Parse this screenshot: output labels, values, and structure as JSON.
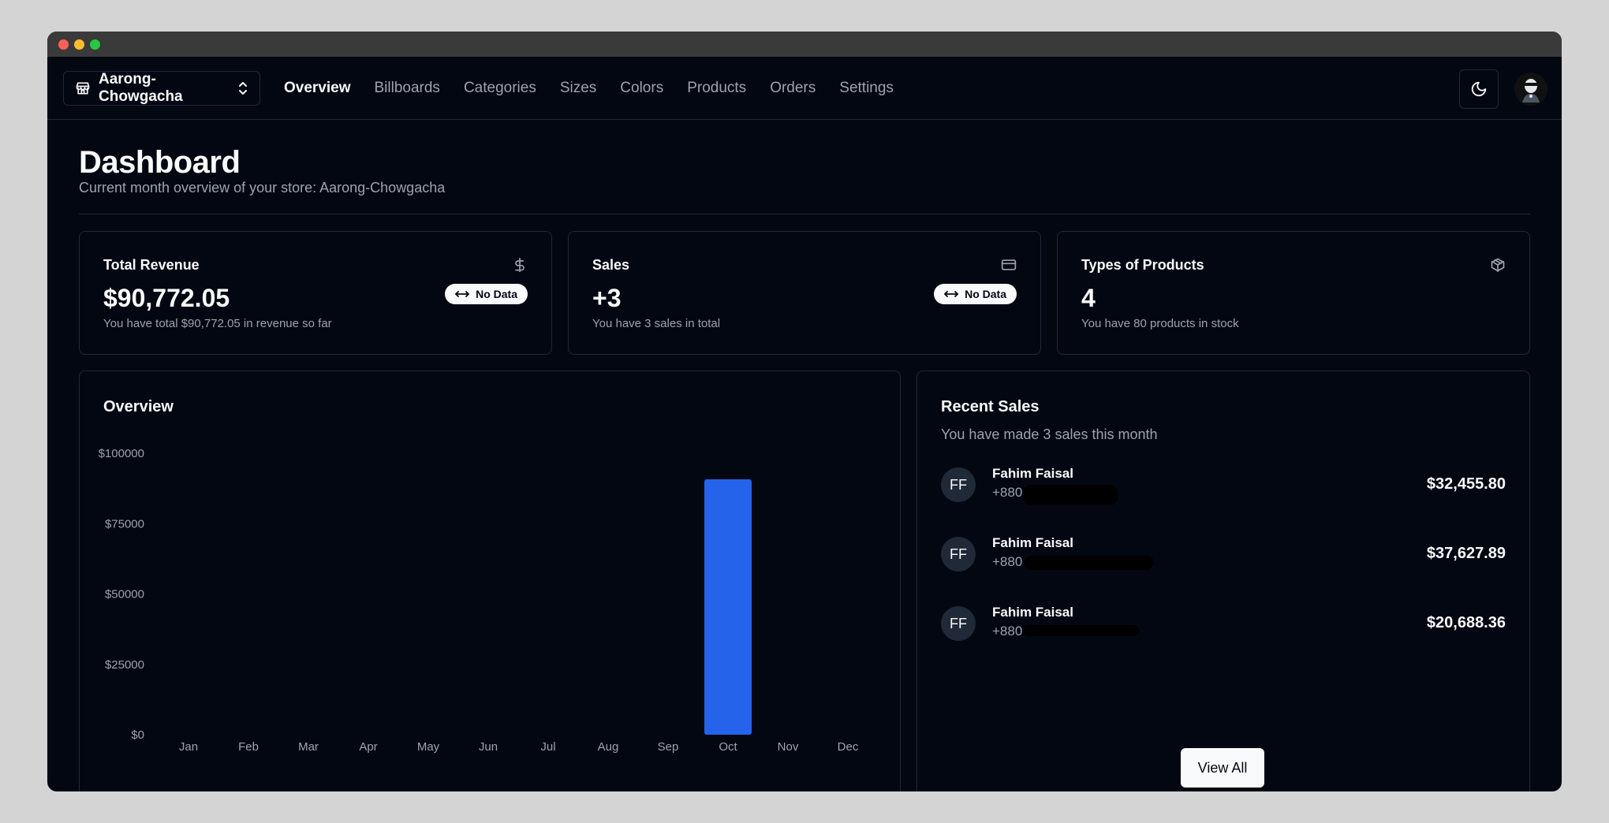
{
  "store": {
    "name": "Aarong-Chowgacha"
  },
  "nav": {
    "items": [
      {
        "label": "Overview",
        "active": true
      },
      {
        "label": "Billboards",
        "active": false
      },
      {
        "label": "Categories",
        "active": false
      },
      {
        "label": "Sizes",
        "active": false
      },
      {
        "label": "Colors",
        "active": false
      },
      {
        "label": "Products",
        "active": false
      },
      {
        "label": "Orders",
        "active": false
      },
      {
        "label": "Settings",
        "active": false
      }
    ]
  },
  "header": {
    "title": "Dashboard",
    "subtitle": "Current month overview of your store: Aarong-Chowgacha"
  },
  "stats": [
    {
      "title": "Total Revenue",
      "value": "$90,772.05",
      "desc": "You have total $90,772.05 in revenue so far",
      "icon": "dollar-icon",
      "badge": "No Data"
    },
    {
      "title": "Sales",
      "value": "+3",
      "desc": "You have 3 sales in total",
      "icon": "credit-card-icon",
      "badge": "No Data"
    },
    {
      "title": "Types of Products",
      "value": "4",
      "desc": "You have 80 products in stock",
      "icon": "package-icon"
    }
  ],
  "overview": {
    "title": "Overview"
  },
  "chart_data": {
    "type": "bar",
    "title": "Overview",
    "categories": [
      "Jan",
      "Feb",
      "Mar",
      "Apr",
      "May",
      "Jun",
      "Jul",
      "Aug",
      "Sep",
      "Oct",
      "Nov",
      "Dec"
    ],
    "values": [
      0,
      0,
      0,
      0,
      0,
      0,
      0,
      0,
      0,
      90772.05,
      0,
      0
    ],
    "yticks": [
      "$100000",
      "$75000",
      "$50000",
      "$25000",
      "$0"
    ],
    "ylim": [
      0,
      100000
    ],
    "bar_color": "#2563eb",
    "grid": false
  },
  "recent": {
    "title": "Recent Sales",
    "subtitle": "You have made 3 sales this month",
    "sales": [
      {
        "initials": "FF",
        "name": "Fahim Faisal",
        "phone": "+880",
        "amount": "$32,455.80"
      },
      {
        "initials": "FF",
        "name": "Fahim Faisal",
        "phone": "+880",
        "amount": "$37,627.89"
      },
      {
        "initials": "FF",
        "name": "Fahim Faisal",
        "phone": "+880",
        "amount": "$20,688.36"
      }
    ],
    "view_all": "View All"
  }
}
